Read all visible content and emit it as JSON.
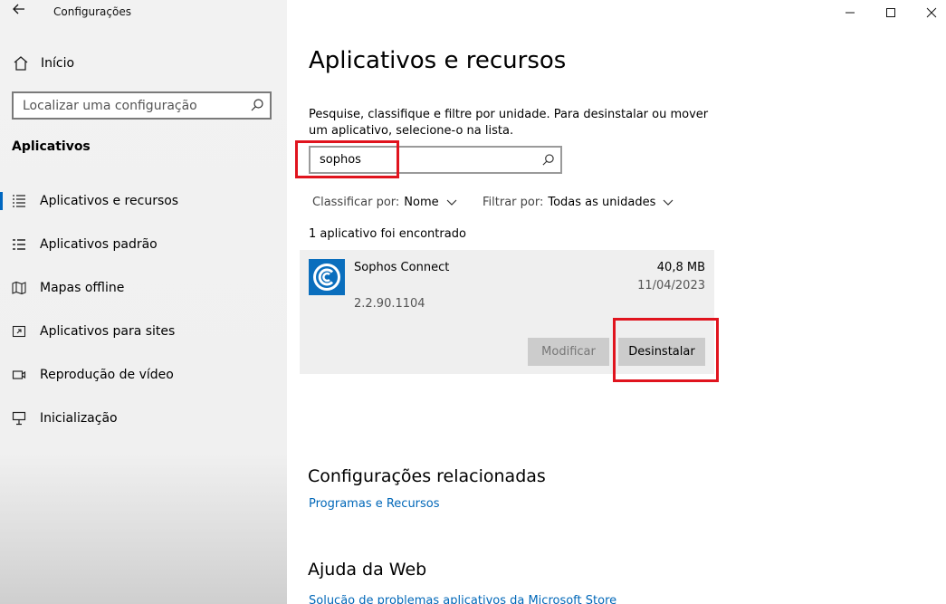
{
  "window": {
    "title": "Configurações"
  },
  "sidebar": {
    "home_label": "Início",
    "search_placeholder": "Localizar uma configuração",
    "section_title": "Aplicativos",
    "items": [
      {
        "label": "Aplicativos e recursos",
        "icon": "apps-list-icon"
      },
      {
        "label": "Aplicativos padrão",
        "icon": "default-apps-icon"
      },
      {
        "label": "Mapas offline",
        "icon": "map-icon"
      },
      {
        "label": "Aplicativos para sites",
        "icon": "open-website-icon"
      },
      {
        "label": "Reprodução de vídeo",
        "icon": "video-icon"
      },
      {
        "label": "Inicialização",
        "icon": "startup-icon"
      }
    ]
  },
  "main": {
    "title": "Aplicativos e recursos",
    "description": "Pesquise, classifique e filtre por unidade. Para desinstalar ou mover um aplicativo, selecione-o na lista.",
    "search_value": "sophos",
    "sort_label": "Classificar por:",
    "sort_value": "Nome",
    "filter_label": "Filtrar por:",
    "filter_value": "Todas as unidades",
    "found_text": "1 aplicativo foi encontrado",
    "app": {
      "name": "Sophos Connect",
      "size": "40,8 MB",
      "date": "11/04/2023",
      "version": "2.2.90.1104",
      "modify_label": "Modificar",
      "uninstall_label": "Desinstalar"
    },
    "related_title": "Configurações relacionadas",
    "related_link": "Programas e Recursos",
    "web_help_title": "Ajuda da Web",
    "web_help_link": "Solução de problemas aplicativos da Microsoft Store"
  },
  "colors": {
    "accent": "#0067c0",
    "link": "#0067b8",
    "highlight": "#e0141e",
    "app_icon": "#0a6ebd"
  }
}
